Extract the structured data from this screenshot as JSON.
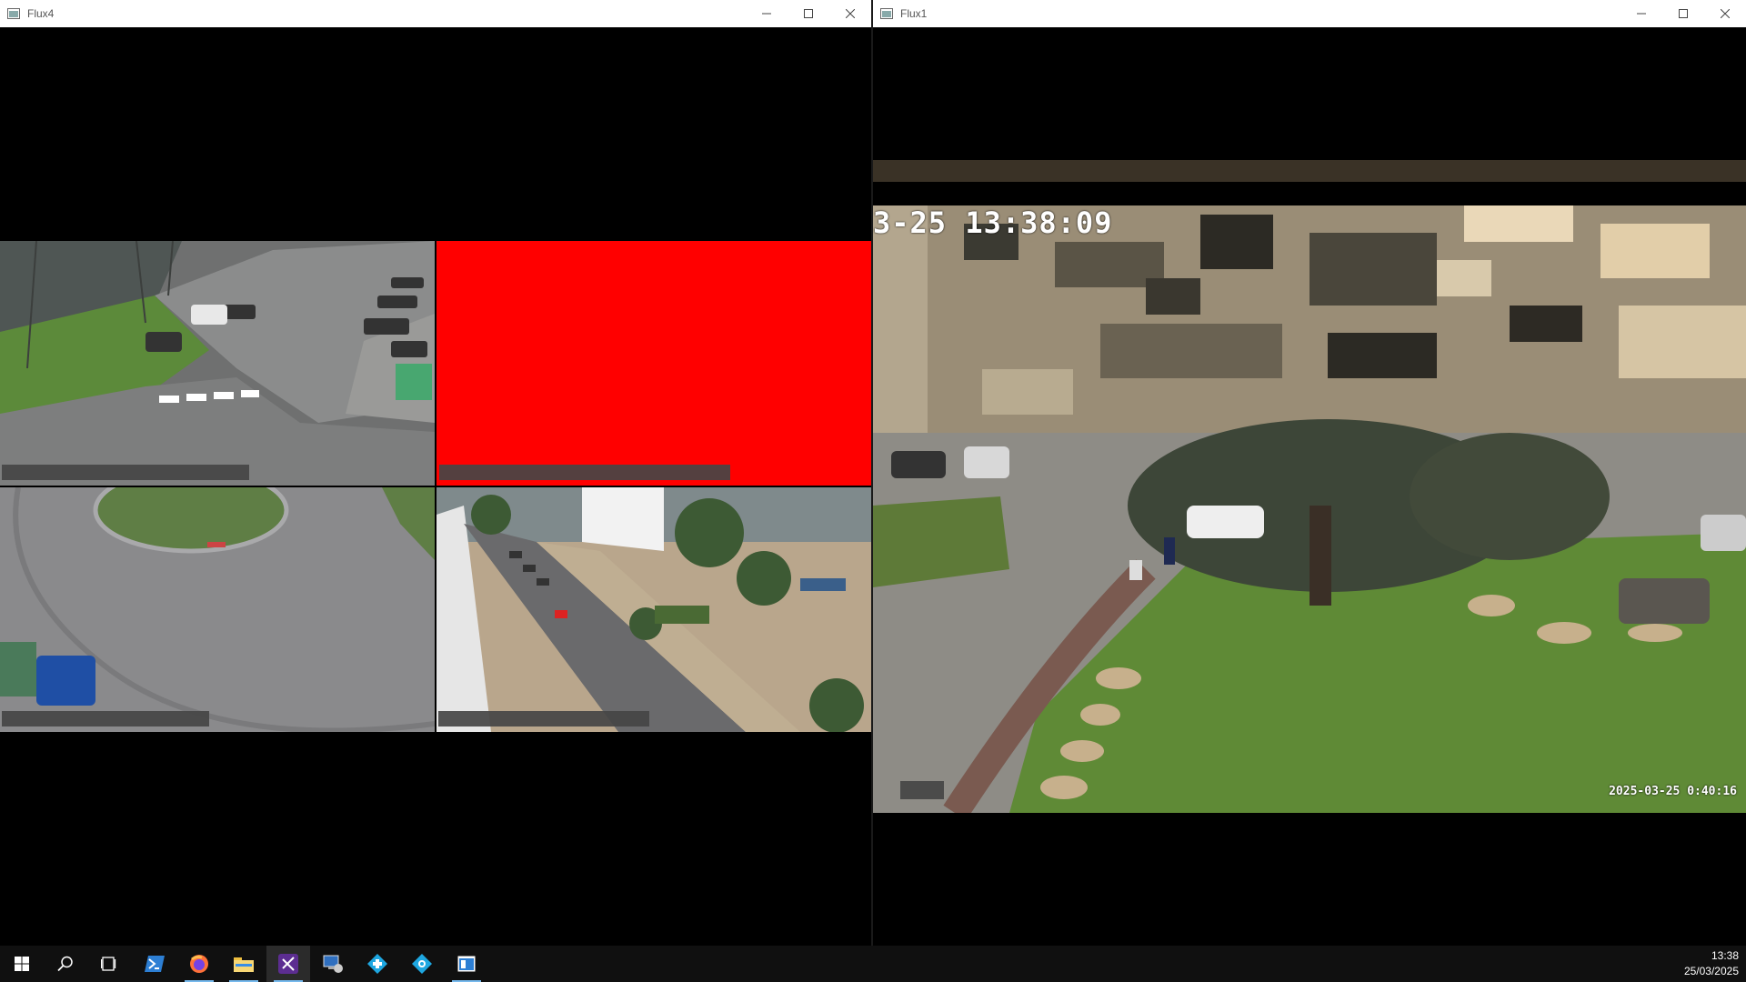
{
  "windows": {
    "left": {
      "title": "Flux4"
    },
    "right": {
      "title": "Flux1"
    }
  },
  "icons": {
    "app": "app-window-icon",
    "minimize": "minimize-icon",
    "maximize": "maximize-icon",
    "close": "close-icon"
  },
  "camera_main": {
    "timestamp_top": "3-25 13:38:09",
    "timestamp_bottom": "2025-03-25 0:40:16"
  },
  "taskbar": {
    "items": [
      "start-icon",
      "search-icon",
      "task-view-icon",
      "powershell-icon",
      "firefox-icon",
      "file-explorer-icon",
      "visual-studio-icon",
      "remote-desktop-icon",
      "network-app-icon",
      "settings-app-icon",
      "video-viewer-icon"
    ],
    "time": "13:38",
    "date": "25/03/2025"
  },
  "colors": {
    "no_signal": "#ff0000",
    "taskbar_bg": "#101010",
    "accent": "#76b9ed"
  }
}
